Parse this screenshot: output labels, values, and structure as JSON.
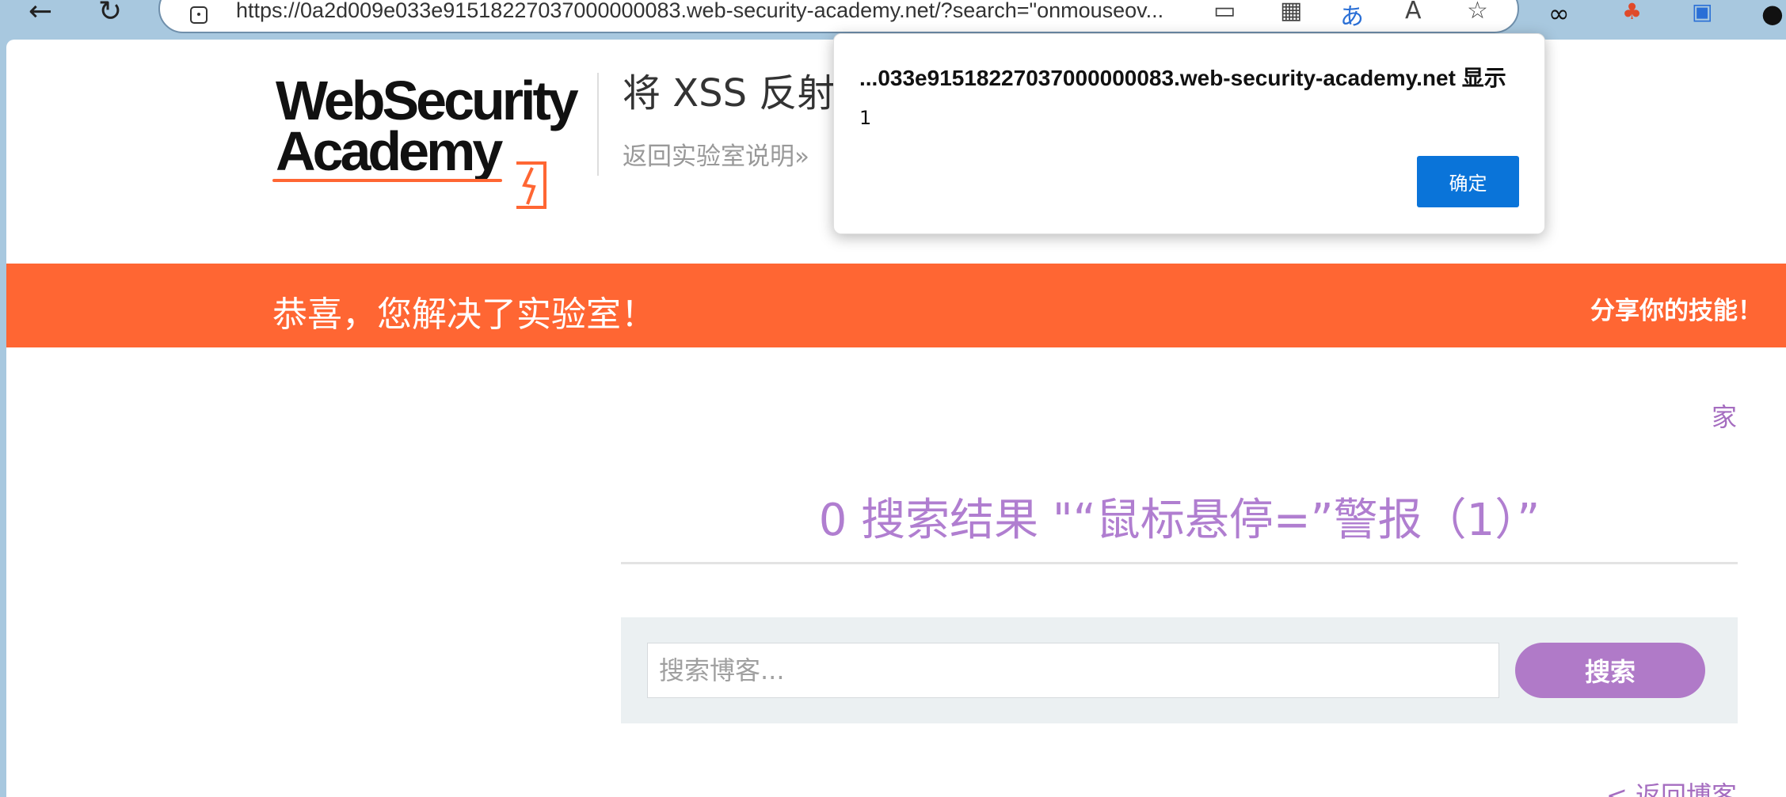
{
  "browser": {
    "url": "https://0a2d009e033e91518227037000000083.web-security-academy.net/?search=\"onmouseov..."
  },
  "header": {
    "logo_line1": "WebSecurity",
    "logo_line2": "Academy",
    "lab_title": "将 XSS 反射",
    "back_to_lab": "返回实验室说明",
    "back_chevrons": "»"
  },
  "banner": {
    "message": "恭喜，您解决了实验室！",
    "share": "分享你的技能！"
  },
  "content": {
    "home": "家",
    "results_heading": "0 搜索结果 \"“鼠标悬停=”警报（1）”",
    "search_placeholder": "搜索博客...",
    "search_button": "搜索",
    "back_to_blog": "< 返回博客"
  },
  "dialog": {
    "title": "...033e91518227037000000083.web-security-academy.net 显示",
    "message": "1",
    "ok": "确定"
  },
  "colors": {
    "accent_orange": "#ff6633",
    "purple": "#b07ac8",
    "dialog_button": "#0a74d9"
  }
}
